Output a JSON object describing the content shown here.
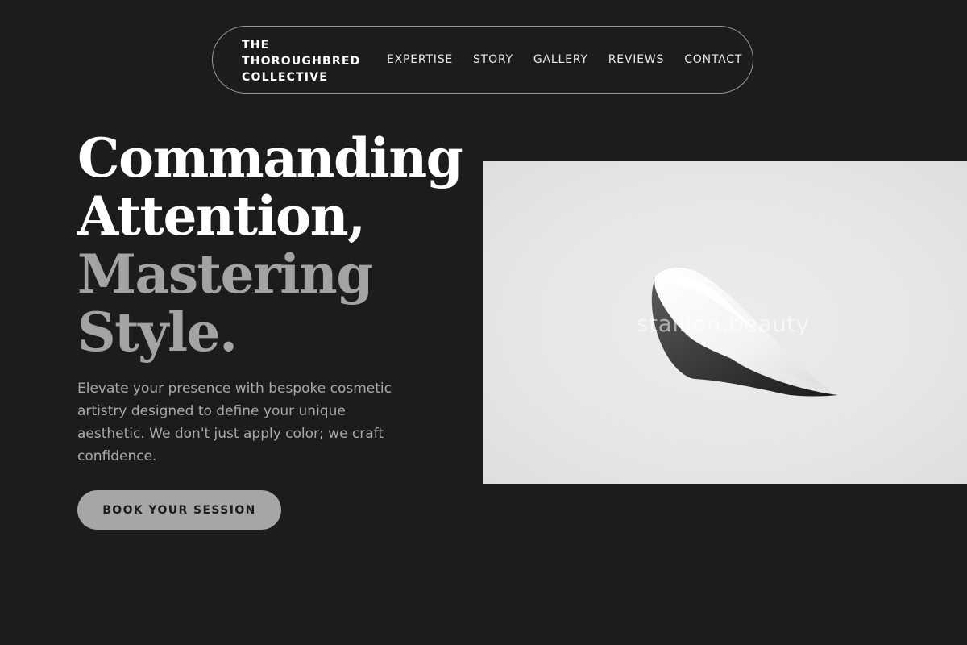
{
  "brand": {
    "line1": "THE",
    "line2": "THOROUGHBRED",
    "line3": "COLLECTIVE"
  },
  "nav": {
    "items": [
      {
        "label": "EXPERTISE"
      },
      {
        "label": "STORY"
      },
      {
        "label": "GALLERY"
      },
      {
        "label": "REVIEWS"
      },
      {
        "label": "CONTACT"
      }
    ]
  },
  "hero": {
    "headline": {
      "line1": "Commanding",
      "line2": "Attention,",
      "line3": "Mastering",
      "line4": "Style."
    },
    "lead": "Elevate your presence with bespoke cosmetic artistry designed to define your unique aesthetic. We don't just apply color; we craft confidence.",
    "cta_label": "BOOK YOUR SESSION",
    "image": {
      "subject": "cream-swatch",
      "watermark": "stallion.beauty"
    }
  },
  "colors": {
    "background": "#1c1c1c",
    "headline_primary": "#ffffff",
    "headline_secondary": "#a3a3a3",
    "body_text": "#a9a9a9",
    "cta_background": "#a6a6a6",
    "nav_border": "#9a9a9a"
  }
}
